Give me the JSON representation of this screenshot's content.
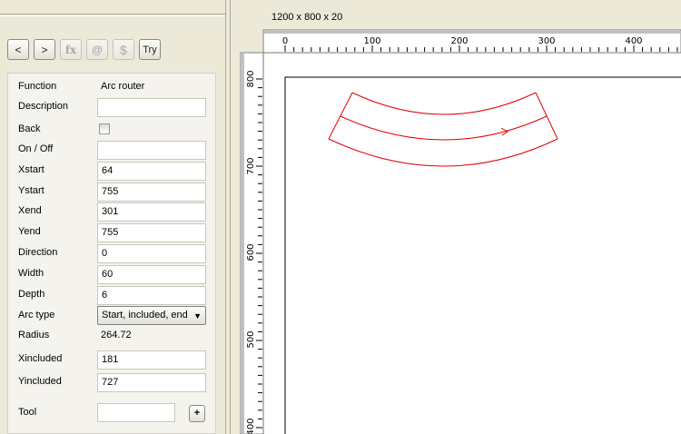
{
  "toolbar": {
    "back_label": "<",
    "forward_label": ">",
    "fx_label": "fx",
    "at_label": "@",
    "dollar_label": "$",
    "try_label": "Try"
  },
  "properties": {
    "function_label": "Function",
    "function_value": "Arc router",
    "description_label": "Description",
    "description_value": "",
    "back_label": "Back",
    "back_checked": false,
    "onoff_label": "On / Off",
    "onoff_value": "",
    "xstart_label": "Xstart",
    "xstart_value": "64",
    "ystart_label": "Ystart",
    "ystart_value": "755",
    "xend_label": "Xend",
    "xend_value": "301",
    "yend_label": "Yend",
    "yend_value": "755",
    "direction_label": "Direction",
    "direction_value": "0",
    "width_label": "Width",
    "width_value": "60",
    "depth_label": "Depth",
    "depth_value": "6",
    "arctype_label": "Arc type",
    "arctype_value": "Start, included, end",
    "radius_label": "Radius",
    "radius_value": "264.72",
    "xincluded_label": "Xincluded",
    "xincluded_value": "181",
    "yincluded_label": "Yincluded",
    "yincluded_value": "727",
    "tool_label": "Tool",
    "tool_value": "",
    "tool_add_label": "+"
  },
  "canvas": {
    "dimensions_label": "1200 x 800 x 20",
    "top_ruler_ticks": [
      "0",
      "100",
      "200",
      "300",
      "400"
    ],
    "left_ruler_ticks": [
      "800",
      "700",
      "600",
      "500",
      "400"
    ],
    "shape_color": "#e00000"
  }
}
